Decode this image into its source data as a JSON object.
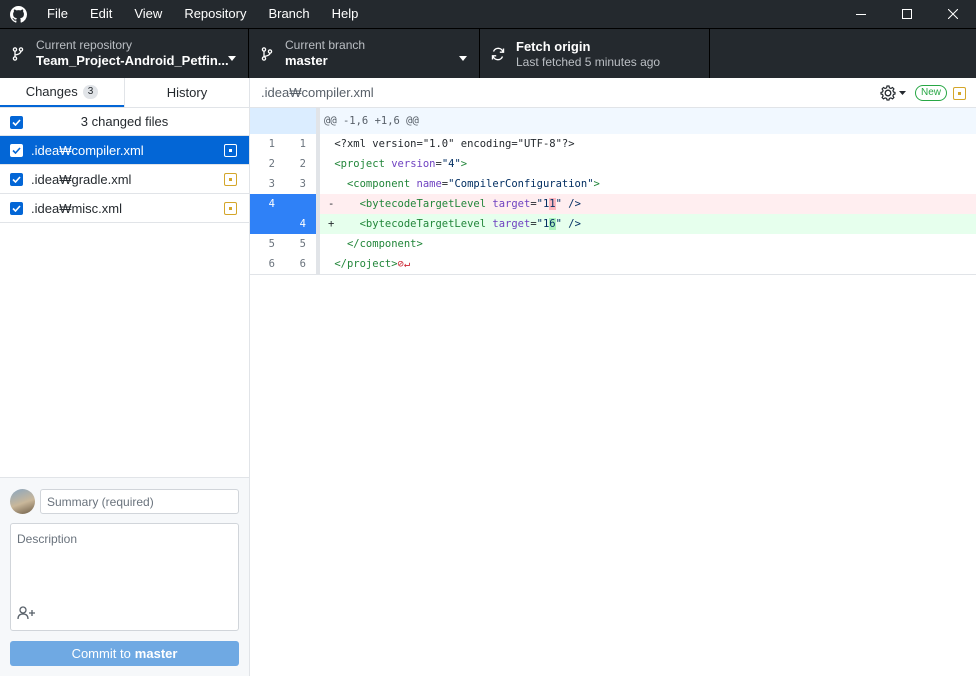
{
  "menu": [
    "File",
    "Edit",
    "View",
    "Repository",
    "Branch",
    "Help"
  ],
  "toolbar": {
    "repo_label": "Current repository",
    "repo_value": "Team_Project-Android_Petfin...",
    "branch_label": "Current branch",
    "branch_value": "master",
    "fetch_label": "Fetch origin",
    "fetch_sub": "Last fetched 5 minutes ago"
  },
  "tabs": {
    "changes": "Changes",
    "changes_count": "3",
    "history": "History"
  },
  "changes": {
    "header": "3 changed files",
    "files": [
      ".idea₩compiler.xml",
      ".idea₩gradle.xml",
      ".idea₩misc.xml"
    ]
  },
  "commit": {
    "summary_placeholder": "Summary (required)",
    "description_placeholder": "Description",
    "button_prefix": "Commit to",
    "button_branch": "master"
  },
  "diff": {
    "path": ".idea₩compiler.xml",
    "new_badge": "New",
    "hunk_header": "@@ -1,6 +1,6 @@",
    "lines": [
      {
        "old": "1",
        "new": "1",
        "sign": " "
      },
      {
        "old": "2",
        "new": "2",
        "sign": " "
      },
      {
        "old": "3",
        "new": "3",
        "sign": " "
      },
      {
        "old": "4",
        "new": "",
        "sign": "-"
      },
      {
        "old": "",
        "new": "4",
        "sign": "+"
      },
      {
        "old": "5",
        "new": "5",
        "sign": " "
      },
      {
        "old": "6",
        "new": "6",
        "sign": " "
      }
    ],
    "code": {
      "l1": "<?xml version=\"1.0\" encoding=\"UTF-8\"?>",
      "l2_tag": "<project",
      "l2_attr": " version",
      "l2_eq": "=",
      "l2_str": "\"4\"",
      "l2_close": ">",
      "l3_tag": "  <component",
      "l3_attr": " name",
      "l3_eq": "=",
      "l3_str": "\"CompilerConfiguration\"",
      "l3_close": ">",
      "l4_tag": "    <bytecodeTargetLevel",
      "l4_attr": " target",
      "l4_eq": "=",
      "l4_q": "\"1",
      "l4_hl": "1",
      "l4_close": "\" />",
      "l5_tag": "    <bytecodeTargetLevel",
      "l5_attr": " target",
      "l5_eq": "=",
      "l5_q": "\"1",
      "l5_hl": "6",
      "l5_close": "\" />",
      "l6": "  </component>",
      "l7": "</project>",
      "eof_mark": "⊘↵"
    }
  },
  "colors": {
    "accent": "#0366d6",
    "titlebar": "#24292e",
    "added": "#28a745",
    "modified": "#d4a62a"
  }
}
